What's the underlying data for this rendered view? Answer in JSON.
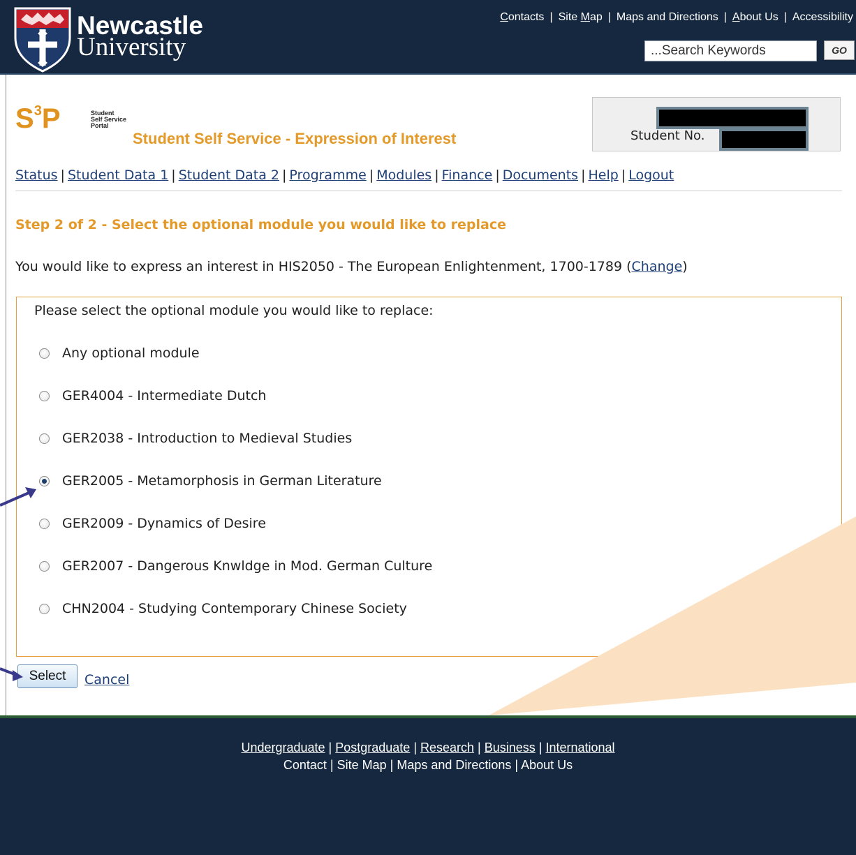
{
  "header": {
    "logo_line1": "Newcastle",
    "logo_line2": "University",
    "top_links": [
      {
        "first": "C",
        "rest": "ontacts"
      },
      {
        "first": "Site ",
        "u": "M",
        "rest": "ap"
      },
      {
        "first": "Maps and Directions",
        "rest": ""
      },
      {
        "first": "A",
        "rest": "bout Us"
      },
      {
        "first": "Accessibility",
        "rest": ""
      }
    ],
    "search_placeholder": "...Search Keywords",
    "go_label": "GO"
  },
  "portal": {
    "s3p_letters_s": "S",
    "s3p_sup": "3",
    "s3p_letters_p": "P",
    "s3p_small_1": "Student",
    "s3p_small_2": "Self Service",
    "s3p_small_3": "Portal",
    "title": "Student Self Service - Expression of Interest",
    "student_no_label": "Student No."
  },
  "nav": {
    "items": [
      "Status",
      "Student Data 1",
      "Student Data 2",
      "Programme",
      "Modules",
      "Finance",
      "Documents",
      "Help",
      "Logout"
    ]
  },
  "content": {
    "step_title": "Step 2 of 2 - Select the optional module you would like to replace",
    "interest_text": "You would like to express an interest in HIS2050 - The European Enlightenment, 1700-1789 (",
    "change_link": "Change",
    "interest_close": ")",
    "prompt": "Please select the optional module you would like to replace:",
    "options": [
      {
        "label": "Any optional module",
        "checked": false
      },
      {
        "label": "GER4004 - Intermediate Dutch",
        "checked": false
      },
      {
        "label": "GER2038 - Introduction to Medieval Studies",
        "checked": false
      },
      {
        "label": "GER2005 - Metamorphosis in German Literature",
        "checked": true
      },
      {
        "label": "GER2009 - Dynamics of Desire",
        "checked": false
      },
      {
        "label": "GER2007 - Dangerous Knwldge in Mod. German Culture",
        "checked": false
      },
      {
        "label": "CHN2004 - Studying Contemporary Chinese Society",
        "checked": false
      }
    ],
    "select_label": "Select",
    "cancel_label": "Cancel"
  },
  "footer": {
    "line1": [
      "Undergraduate",
      "Postgraduate",
      "Research",
      "Business",
      "International"
    ],
    "line2": [
      "Contact",
      "Site Map",
      "Maps and Directions",
      "About Us"
    ]
  },
  "colors": {
    "header_bg": "#15283f",
    "accent_orange": "#e39a2a",
    "link_blue": "#1f3f77",
    "arrow": "#3a3a8c"
  }
}
